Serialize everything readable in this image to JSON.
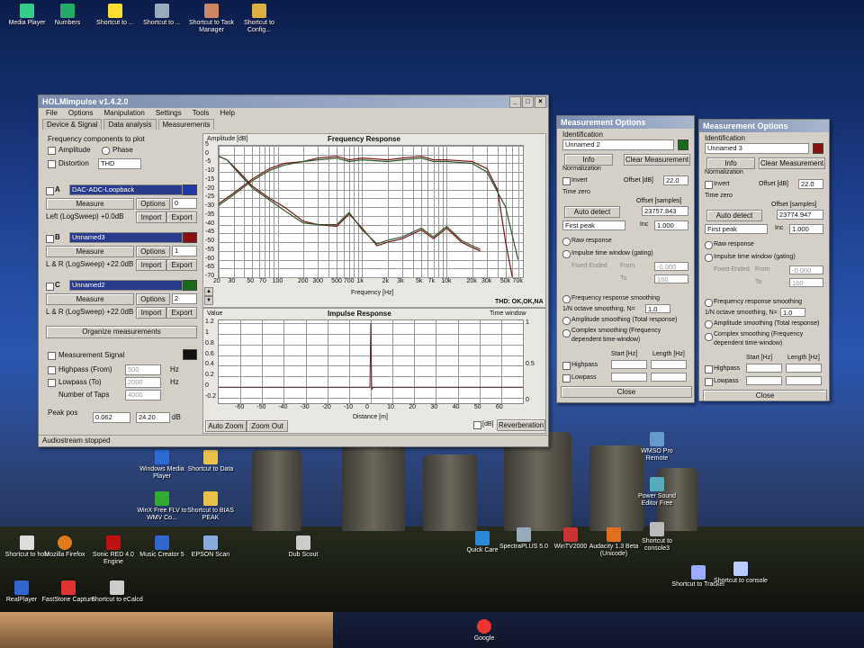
{
  "desktop": {
    "icons_top_left": [
      "Media Player",
      "Numbers",
      "Shortcut to ...",
      "Shortcut to ...",
      "Shortcut to Task Manager",
      "Shortcut to Config..."
    ],
    "icons_bottom": [
      {
        "label": "Shortcut to holx"
      },
      {
        "label": "Mozilla Firefox"
      },
      {
        "label": "Sonic RED 4.0 Engine"
      },
      {
        "label": "Music Creator 5"
      },
      {
        "label": "EPSON Scan"
      },
      {
        "label": "Dub Scout"
      },
      {
        "label": "Quick Care"
      },
      {
        "label": "SpectraPLUS 5.0"
      },
      {
        "label": "WinTV2000"
      },
      {
        "label": "Audacity 1.3 Beta (Unicode)"
      },
      {
        "label": "Shortcut to console3"
      },
      {
        "label": "Shortcut to Tracker"
      },
      {
        "label": "Shortcut to console"
      },
      {
        "label": "Google"
      },
      {
        "label": "RealPlayer"
      },
      {
        "label": "FastStone Capture"
      },
      {
        "label": "Shortcut to eCalcd"
      },
      {
        "label": "Windows Media Player"
      },
      {
        "label": "Shortcut to Data"
      },
      {
        "label": "WinX Free FLV to WMV Co..."
      },
      {
        "label": "Shortcut to BIAS PEAK"
      },
      {
        "label": "Power Sound Editor Free"
      },
      {
        "label": "WMSO Pro Remote"
      }
    ]
  },
  "main": {
    "title": "HOLMImpulse v1.4.2.0",
    "menu": [
      "File",
      "Options",
      "Manipulation",
      "Settings",
      "Tools",
      "Help"
    ],
    "tabs": [
      "Device & Signal",
      "Data analysis",
      "Measurements"
    ],
    "freq_components": "Frequency components to plot",
    "amplitude": "Amplitude",
    "phase": "Phase",
    "distortion": "Distortion",
    "thd": "THD",
    "measurements": [
      {
        "letter": "A",
        "name": "DAC-ADC-Loopback",
        "color": "#1d3aa8",
        "measure": "Measure",
        "options": "Options",
        "opt_val": "0",
        "desc": "Left (LogSweep) +0.0dB",
        "import": "Import",
        "export": "Export"
      },
      {
        "letter": "B",
        "name": "Unnamed3",
        "color": "#8a1010",
        "measure": "Measure",
        "options": "Options",
        "opt_val": "1",
        "desc": "L & R (LogSweep) +22.0dB",
        "import": "Import",
        "export": "Export"
      },
      {
        "letter": "C",
        "name": "Unnamed2",
        "color": "#1a6a1a",
        "measure": "Measure",
        "options": "Options",
        "opt_val": "2",
        "desc": "L & R (LogSweep) +22.0dB",
        "import": "Import",
        "export": "Export"
      }
    ],
    "organize": "Organize measurements",
    "measurement_signal": "Measurement Signal",
    "highpass": "Highpass (From)",
    "lowpass": "Lowpass (To)",
    "taps": "Number of Taps",
    "hp_val": "500",
    "lp_val": "2000",
    "taps_val": "4000",
    "hz": "Hz",
    "peak_pos": "Peak pos",
    "peak_a": "0.062",
    "peak_b": "24.20",
    "db": "dB",
    "status": "Audiostream stopped",
    "freq_plot": {
      "ylabel": "Amplitude [dB]",
      "title": "Frequency Response",
      "xlabel": "Frequency [Hz]",
      "thd_label": "THD: OK,OK,NA",
      "yticks": [
        "5",
        "0",
        "-5",
        "-10",
        "-15",
        "-20",
        "-25",
        "-30",
        "-35",
        "-40",
        "-45",
        "-50",
        "-55",
        "-60",
        "-65",
        "-70"
      ],
      "xticks": [
        "20",
        "30",
        "50",
        "70",
        "100",
        "200",
        "300",
        "500",
        "700",
        "1k",
        "2k",
        "3k",
        "5k",
        "7k",
        "10k",
        "20k",
        "30k",
        "50k",
        "70k"
      ]
    },
    "imp_plot": {
      "ylabel": "Value",
      "title": "Impulse Response",
      "tw": "Time window",
      "xlabel": "Distance [m]",
      "yticks": [
        "1.2",
        "1",
        "0.8",
        "0.6",
        "0.4",
        "0.2",
        "0",
        "-0.2"
      ],
      "xticks": [
        "-60",
        "-50",
        "-40",
        "-30",
        "-20",
        "-10",
        "0",
        "10",
        "20",
        "30",
        "40",
        "50",
        "60"
      ],
      "rticks": [
        "1",
        "0.5",
        "0"
      ],
      "db_label": "[dB]",
      "reverb": "Reverberation",
      "auto_zoom": "Auto Zoom",
      "zoom_out": "Zoom Out"
    }
  },
  "side_panels": [
    {
      "title": "Measurement Options",
      "identification": "Identification",
      "ident_val": "Unnamed 2",
      "info": "Info",
      "clear": "Clear Measurement",
      "normalization": "Normalization",
      "invert": "Invert",
      "offset_db": "Offset [dB]",
      "offset_val": "22.0",
      "time_zero": "Time zero",
      "offset_samples": "Offset [samples]",
      "samples_val": "23757.843",
      "auto_detect": "Auto detect",
      "first_peak": "First peak",
      "inc": "Inc",
      "inc_val": "1.000",
      "raw": "Raw response",
      "imp_tw": "Impulse time window (gating)",
      "fixed": "Fixed-Ended",
      "from": "From",
      "to": "To",
      "from_val": "-0.000",
      "to_val": "160",
      "fr_smoothing": "Frequency response smoothing",
      "octave": "1/N octave smoothing, N=",
      "octave_val": "1.0",
      "amp_smoothing": "Amplitude smoothing (Total response)",
      "complex_smoothing": "Complex smoothing (Frequency dependent time-window)",
      "start_hz": "Start [Hz]",
      "length_hz": "Length [Hz]",
      "highpass": "Highpass",
      "lowpass": "Lowpass",
      "close": "Close",
      "swatch": "#1a6a1a"
    },
    {
      "title": "Measurement Options",
      "identification": "Identification",
      "ident_val": "Unnamed 3",
      "info": "Info",
      "clear": "Clear Measurement",
      "normalization": "Normalization",
      "invert": "Invert",
      "offset_db": "Offset [dB]",
      "offset_val": "22.0",
      "time_zero": "Time zero",
      "offset_samples": "Offset [samples]",
      "samples_val": "23774.947",
      "auto_detect": "Auto detect",
      "first_peak": "First peak",
      "inc": "Inc",
      "inc_val": "1.000",
      "raw": "Raw response",
      "imp_tw": "Impulse time window (gating)",
      "fixed": "Fixed-Ended",
      "from": "From",
      "to": "To",
      "from_val": "-0.000",
      "to_val": "160",
      "fr_smoothing": "Frequency response smoothing",
      "octave": "1/N octave smoothing, N=",
      "octave_val": "1.0",
      "amp_smoothing": "Amplitude smoothing (Total response)",
      "complex_smoothing": "Complex smoothing (Frequency dependent time-window)",
      "start_hz": "Start [Hz]",
      "length_hz": "Length [Hz]",
      "highpass": "Highpass",
      "lowpass": "Lowpass",
      "close": "Close",
      "swatch": "#8a1010"
    }
  ]
}
